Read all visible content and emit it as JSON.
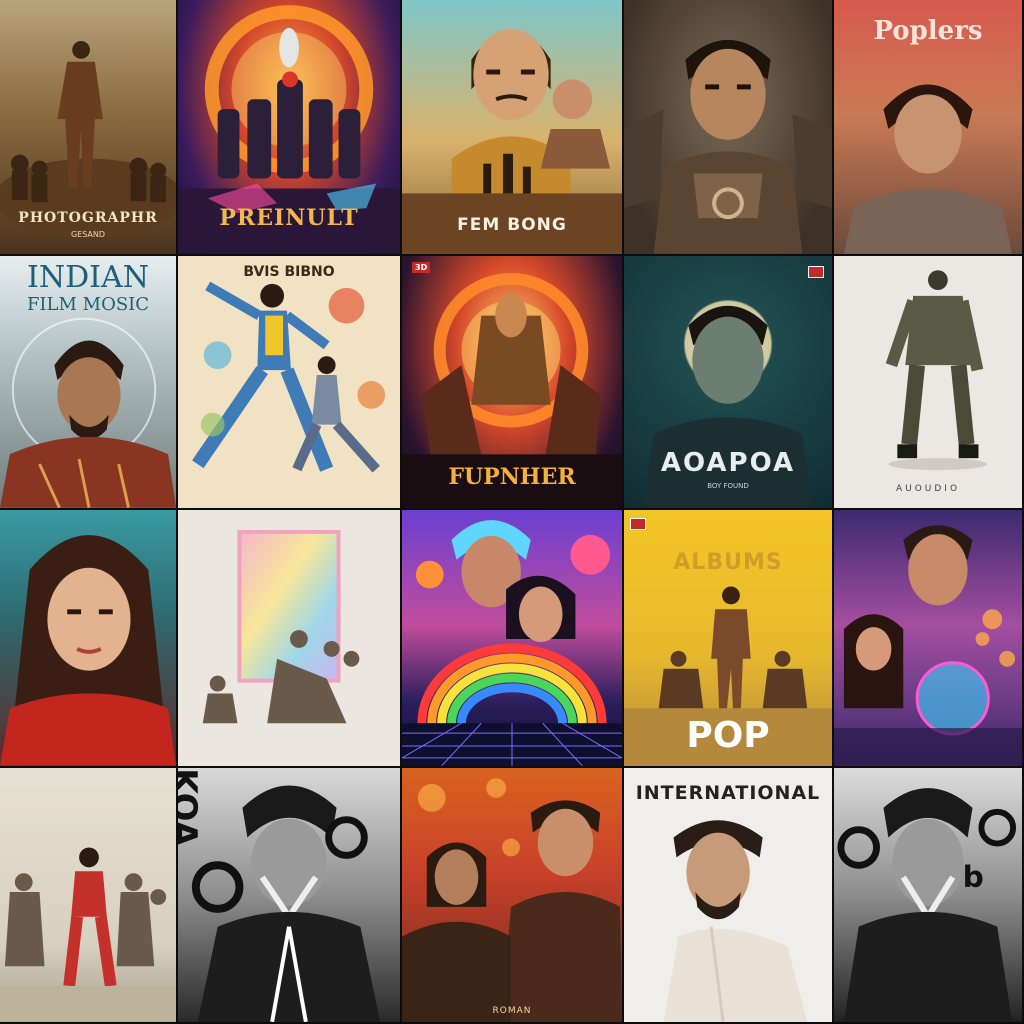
{
  "posters": {
    "p1": {
      "title": "PHOTOGRAPHR",
      "subtitle": "GESAND"
    },
    "p2": {
      "title": "PREINULT"
    },
    "p3": {
      "title": "FEM BONG"
    },
    "p4": {
      "title": ""
    },
    "p5": {
      "title": "Poplers",
      "subtitle": ""
    },
    "p6": {
      "title_line1": "INDIAN",
      "title_line2": "FILM MOSIC"
    },
    "p7": {
      "title": "BVIS BIBNO",
      "subtitle": ""
    },
    "p8": {
      "title": "FUPNHER",
      "badge": "3D"
    },
    "p9": {
      "title": "AOAPOA",
      "subtitle": "BOY FOUND",
      "badge": ""
    },
    "p10": {
      "title": "AUOUDIO"
    },
    "p11": {
      "title": ""
    },
    "p12": {
      "title": ""
    },
    "p13": {
      "title": ""
    },
    "p14": {
      "title": "ALBUMS",
      "subtitle": "POP",
      "badge": ""
    },
    "p15": {
      "title": ""
    },
    "p16": {
      "title": ""
    },
    "p17": {
      "title": ""
    },
    "p18": {
      "title": "ROMAN"
    },
    "p19": {
      "title": "INTERNATIONAL"
    },
    "p20": {
      "title": ""
    }
  }
}
